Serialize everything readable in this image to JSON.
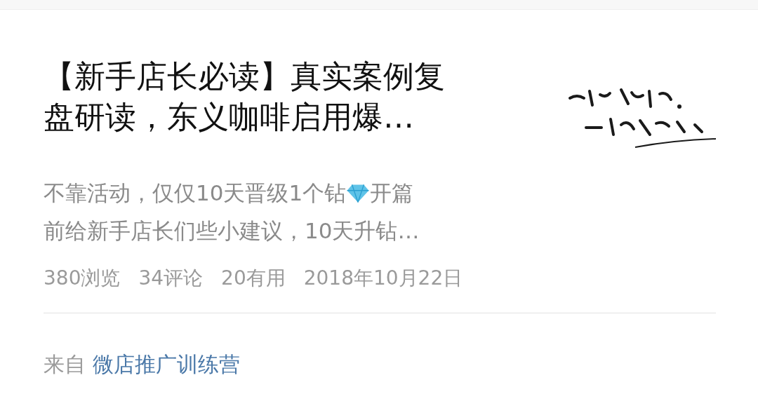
{
  "article": {
    "title": "【新手店长必读】真实案例复盘研读，东义咖啡启用爆…",
    "summary": {
      "before_icon": "不靠活动，仅仅10天晋级1个钻",
      "after_icon": "开篇",
      "second_line": "前给新手店长们些小建议，10天升钻…"
    },
    "stats": [
      "380浏览",
      "34评论",
      "20有用",
      "2018年10月22日"
    ],
    "source": {
      "label": "来自",
      "name": "微店推广训练营"
    }
  }
}
